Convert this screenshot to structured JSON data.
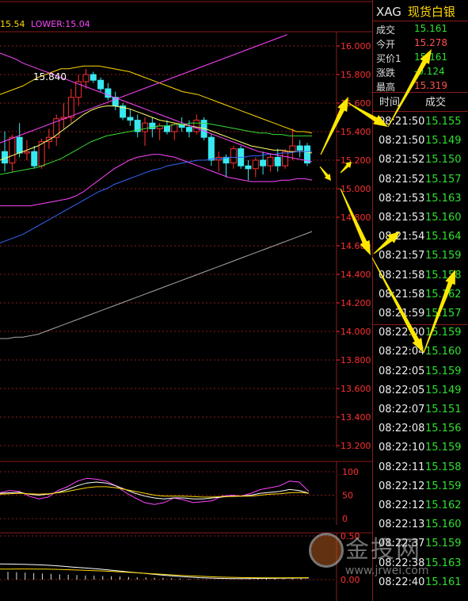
{
  "chart_data": [
    {
      "type": "candlestick",
      "panel": "price",
      "legend": {
        "upper_label": "15.54",
        "lower_label": "LOWER:15.04"
      },
      "annotation": "15.840",
      "ylim": [
        13.2,
        16.1
      ],
      "yticks": [
        "16.000",
        "15.800",
        "15.600",
        "15.400",
        "15.200",
        "15.000",
        "14.800",
        "14.600",
        "14.400",
        "14.200",
        "14.000",
        "13.800",
        "13.600",
        "13.400",
        "13.200"
      ],
      "grid": true,
      "candles": [
        {
          "o": 15.26,
          "h": 15.4,
          "l": 15.12,
          "c": 15.18
        },
        {
          "o": 15.18,
          "h": 15.38,
          "l": 15.12,
          "c": 15.36
        },
        {
          "o": 15.36,
          "h": 15.46,
          "l": 15.22,
          "c": 15.25
        },
        {
          "o": 15.25,
          "h": 15.34,
          "l": 15.2,
          "c": 15.26
        },
        {
          "o": 15.26,
          "h": 15.3,
          "l": 15.14,
          "c": 15.16
        },
        {
          "o": 15.16,
          "h": 15.35,
          "l": 15.14,
          "c": 15.33
        },
        {
          "o": 15.33,
          "h": 15.42,
          "l": 15.28,
          "c": 15.36
        },
        {
          "o": 15.36,
          "h": 15.52,
          "l": 15.3,
          "c": 15.49
        },
        {
          "o": 15.49,
          "h": 15.6,
          "l": 15.42,
          "c": 15.5
        },
        {
          "o": 15.5,
          "h": 15.7,
          "l": 15.46,
          "c": 15.64
        },
        {
          "o": 15.64,
          "h": 15.8,
          "l": 15.58,
          "c": 15.75
        },
        {
          "o": 15.75,
          "h": 15.84,
          "l": 15.7,
          "c": 15.8
        },
        {
          "o": 15.8,
          "h": 15.82,
          "l": 15.74,
          "c": 15.76
        },
        {
          "o": 15.76,
          "h": 15.78,
          "l": 15.68,
          "c": 15.7
        },
        {
          "o": 15.7,
          "h": 15.74,
          "l": 15.62,
          "c": 15.64
        },
        {
          "o": 15.64,
          "h": 15.68,
          "l": 15.55,
          "c": 15.58
        },
        {
          "o": 15.58,
          "h": 15.6,
          "l": 15.48,
          "c": 15.5
        },
        {
          "o": 15.5,
          "h": 15.56,
          "l": 15.44,
          "c": 15.48
        },
        {
          "o": 15.48,
          "h": 15.52,
          "l": 15.36,
          "c": 15.4
        },
        {
          "o": 15.4,
          "h": 15.5,
          "l": 15.3,
          "c": 15.46
        },
        {
          "o": 15.46,
          "h": 15.5,
          "l": 15.36,
          "c": 15.42
        },
        {
          "o": 15.42,
          "h": 15.46,
          "l": 15.34,
          "c": 15.44
        },
        {
          "o": 15.44,
          "h": 15.48,
          "l": 15.38,
          "c": 15.4
        },
        {
          "o": 15.4,
          "h": 15.46,
          "l": 15.34,
          "c": 15.45
        },
        {
          "o": 15.45,
          "h": 15.5,
          "l": 15.4,
          "c": 15.43
        },
        {
          "o": 15.43,
          "h": 15.48,
          "l": 15.36,
          "c": 15.4
        },
        {
          "o": 15.4,
          "h": 15.52,
          "l": 15.38,
          "c": 15.48
        },
        {
          "o": 15.48,
          "h": 15.5,
          "l": 15.34,
          "c": 15.36
        },
        {
          "o": 15.36,
          "h": 15.38,
          "l": 15.16,
          "c": 15.2
        },
        {
          "o": 15.2,
          "h": 15.26,
          "l": 15.12,
          "c": 15.22
        },
        {
          "o": 15.22,
          "h": 15.24,
          "l": 15.08,
          "c": 15.18
        },
        {
          "o": 15.18,
          "h": 15.3,
          "l": 15.14,
          "c": 15.28
        },
        {
          "o": 15.28,
          "h": 15.3,
          "l": 15.14,
          "c": 15.16
        },
        {
          "o": 15.16,
          "h": 15.2,
          "l": 15.06,
          "c": 15.14
        },
        {
          "o": 15.14,
          "h": 15.22,
          "l": 15.08,
          "c": 15.2
        },
        {
          "o": 15.2,
          "h": 15.26,
          "l": 15.1,
          "c": 15.16
        },
        {
          "o": 15.16,
          "h": 15.24,
          "l": 15.12,
          "c": 15.22
        },
        {
          "o": 15.22,
          "h": 15.28,
          "l": 15.12,
          "c": 15.16
        },
        {
          "o": 15.16,
          "h": 15.28,
          "l": 15.14,
          "c": 15.26
        },
        {
          "o": 15.26,
          "h": 15.42,
          "l": 15.2,
          "c": 15.3
        },
        {
          "o": 15.3,
          "h": 15.34,
          "l": 15.22,
          "c": 15.27
        },
        {
          "o": 15.3,
          "h": 15.32,
          "l": 15.16,
          "c": 15.18
        }
      ],
      "lines": [
        {
          "name": "upper",
          "color": "#ffd700",
          "values": [
            15.66,
            15.68,
            15.7,
            15.72,
            15.75,
            15.78,
            15.8,
            15.82,
            15.84,
            15.84,
            15.85,
            15.86,
            15.86,
            15.86,
            15.85,
            15.84,
            15.83,
            15.82,
            15.8,
            15.78,
            15.76,
            15.74,
            15.72,
            15.7,
            15.68,
            15.67,
            15.66,
            15.64,
            15.62,
            15.6,
            15.58,
            15.56,
            15.54,
            15.52,
            15.5,
            15.48,
            15.46,
            15.44,
            15.42,
            15.4,
            15.4,
            15.39
          ]
        },
        {
          "name": "mid",
          "color": "#ffff66",
          "values": [
            15.2,
            15.22,
            15.24,
            15.26,
            15.28,
            15.3,
            15.33,
            15.36,
            15.4,
            15.44,
            15.48,
            15.52,
            15.55,
            15.57,
            15.58,
            15.58,
            15.57,
            15.56,
            15.54,
            15.52,
            15.5,
            15.48,
            15.47,
            15.46,
            15.45,
            15.44,
            15.43,
            15.42,
            15.4,
            15.38,
            15.36,
            15.34,
            15.32,
            15.3,
            15.29,
            15.28,
            15.27,
            15.27,
            15.26,
            15.26,
            15.26,
            15.25
          ]
        },
        {
          "name": "lower",
          "color": "#ff44ff",
          "values": [
            14.88,
            14.88,
            14.88,
            14.88,
            14.88,
            14.89,
            14.9,
            14.91,
            14.92,
            14.93,
            14.95,
            14.98,
            15.02,
            15.06,
            15.1,
            15.14,
            15.17,
            15.2,
            15.22,
            15.23,
            15.24,
            15.24,
            15.23,
            15.22,
            15.2,
            15.18,
            15.16,
            15.14,
            15.12,
            15.1,
            15.08,
            15.07,
            15.06,
            15.05,
            15.05,
            15.05,
            15.05,
            15.06,
            15.06,
            15.07,
            15.07,
            15.06
          ]
        },
        {
          "name": "ma_green",
          "color": "#33dd33",
          "values": [
            15.1,
            15.11,
            15.12,
            15.13,
            15.14,
            15.15,
            15.17,
            15.19,
            15.21,
            15.24,
            15.27,
            15.3,
            15.33,
            15.35,
            15.37,
            15.38,
            15.39,
            15.4,
            15.41,
            15.42,
            15.43,
            15.44,
            15.44,
            15.45,
            15.45,
            15.46,
            15.46,
            15.46,
            15.45,
            15.44,
            15.43,
            15.42,
            15.41,
            15.4,
            15.39,
            15.39,
            15.38,
            15.38,
            15.37,
            15.37,
            15.37,
            15.37
          ]
        },
        {
          "name": "ma_blue",
          "color": "#3366ff",
          "values": [
            14.62,
            14.64,
            14.66,
            14.68,
            14.71,
            14.74,
            14.77,
            14.8,
            14.83,
            14.86,
            14.89,
            14.92,
            14.95,
            14.98,
            15.0,
            15.03,
            15.05,
            15.07,
            15.09,
            15.11,
            15.13,
            15.14,
            15.16,
            15.17,
            15.18,
            15.19,
            15.2,
            15.2,
            15.21,
            15.21,
            15.22,
            15.22,
            15.22,
            15.23,
            15.23,
            15.24,
            15.24,
            15.25,
            15.25,
            15.26,
            15.26,
            15.26
          ]
        },
        {
          "name": "ma_gray",
          "color": "#a8a8a8",
          "values": [
            13.95,
            13.95,
            13.96,
            13.96,
            13.97,
            13.98,
            14.0,
            14.02,
            14.04,
            14.06,
            14.08,
            14.1,
            14.12,
            14.14,
            14.16,
            14.18,
            14.2,
            14.22,
            14.24,
            14.26,
            14.28,
            14.3,
            14.32,
            14.34,
            14.36,
            14.38,
            14.4,
            14.42,
            14.44,
            14.46,
            14.48,
            14.5,
            14.52,
            14.54,
            14.56,
            14.58,
            14.6,
            14.62,
            14.64,
            14.66,
            14.68,
            14.7
          ]
        },
        {
          "name": "trend_down",
          "color": "#ff44ff",
          "values": [
            15.95,
            15.93,
            15.91,
            15.88,
            15.86,
            15.84,
            15.82,
            15.8,
            15.78,
            15.76,
            15.74,
            15.72,
            15.7,
            15.68,
            15.66,
            15.64,
            15.62,
            15.6,
            15.58,
            15.56,
            15.54,
            15.52,
            15.5,
            15.48,
            15.46,
            15.44,
            15.42,
            15.4,
            15.38,
            15.36,
            15.34,
            15.32,
            15.3,
            15.28,
            15.26,
            15.25,
            15.24,
            15.23,
            15.22,
            15.21,
            15.2,
            15.19
          ]
        }
      ],
      "trend_up_line": {
        "color": "#ff44ff",
        "from_index": 10,
        "from_value": 15.5,
        "to_index": 34,
        "to_value": 16.08
      }
    },
    {
      "type": "line",
      "panel": "oscillator",
      "ylim": [
        0,
        100
      ],
      "yticks": [
        "100",
        "50",
        "0"
      ],
      "series": [
        {
          "color": "#ff44ff",
          "values": [
            55,
            60,
            58,
            48,
            42,
            46,
            60,
            68,
            80,
            86,
            84,
            80,
            70,
            56,
            44,
            34,
            30,
            34,
            44,
            40,
            34,
            36,
            38,
            48,
            50,
            48,
            54,
            62,
            66,
            70,
            80,
            78,
            58
          ]
        },
        {
          "color": "#ffffff",
          "values": [
            54,
            55,
            56,
            52,
            50,
            52,
            56,
            62,
            70,
            76,
            78,
            76,
            70,
            62,
            54,
            48,
            44,
            42,
            44,
            44,
            42,
            42,
            44,
            46,
            48,
            48,
            50,
            54,
            56,
            58,
            62,
            60,
            54
          ]
        },
        {
          "color": "#ffd700",
          "values": [
            52,
            53,
            54,
            53,
            52,
            53,
            55,
            58,
            62,
            66,
            68,
            68,
            66,
            62,
            58,
            54,
            50,
            48,
            48,
            48,
            47,
            46,
            46,
            47,
            47,
            48,
            48,
            50,
            52,
            53,
            55,
            56,
            54
          ]
        }
      ]
    },
    {
      "type": "bar",
      "panel": "indicator",
      "ylim": [
        0,
        0.5
      ],
      "yticks": [
        "0.50",
        "0.00"
      ],
      "values": [
        0.09,
        0.085,
        0.08,
        0.075,
        0.07,
        0.065,
        0.06,
        0.056,
        0.052,
        0.048,
        0.045,
        0.042,
        0.038,
        0.034,
        0.03,
        0.027,
        0.024,
        0.021,
        0.018,
        0.015,
        0.012,
        0.009,
        0.006,
        0.003,
        0.002,
        0.001,
        0.002,
        0.004,
        0.006,
        0.008,
        0.01,
        0.011,
        0.012,
        0.013,
        0.014
      ],
      "lines": [
        {
          "color": "#ffffff",
          "values": [
            0.18,
            0.178,
            0.176,
            0.174,
            0.17,
            0.166,
            0.16,
            0.152,
            0.144,
            0.136,
            0.128,
            0.12,
            0.11,
            0.1,
            0.09,
            0.08,
            0.07,
            0.06,
            0.05,
            0.042,
            0.034,
            0.028,
            0.022,
            0.018,
            0.015,
            0.013,
            0.012,
            0.012,
            0.013,
            0.014,
            0.015,
            0.016,
            0.017,
            0.018,
            0.019
          ]
        },
        {
          "color": "#ffd700",
          "values": [
            0.12,
            0.121,
            0.122,
            0.122,
            0.121,
            0.12,
            0.118,
            0.115,
            0.112,
            0.108,
            0.104,
            0.1,
            0.095,
            0.09,
            0.084,
            0.078,
            0.072,
            0.066,
            0.06,
            0.054,
            0.048,
            0.043,
            0.038,
            0.034,
            0.03,
            0.027,
            0.025,
            0.023,
            0.022,
            0.021,
            0.021,
            0.021,
            0.022,
            0.022,
            0.023
          ]
        }
      ]
    }
  ],
  "quote": {
    "symbol": "XAG",
    "name": "现货白银",
    "rows": [
      {
        "label": "成交",
        "value": "15.161",
        "color": "#2fe02f"
      },
      {
        "label": "今开",
        "value": "15.278",
        "color": "#ff5050"
      },
      {
        "label": "买价1",
        "value": "15.161",
        "color": "#2fe02f"
      },
      {
        "label": "涨跌",
        "value": "-0.124",
        "color": "#2fe02f"
      },
      {
        "label": "最高",
        "value": "15.319",
        "color": "#ff5050"
      }
    ]
  },
  "ticks": {
    "headers": {
      "time": "时间",
      "price": "成交"
    },
    "rows": [
      {
        "time": "08:21:50",
        "price": "15.155"
      },
      {
        "time": "08:21:50",
        "price": "15.149"
      },
      {
        "time": "08:21:52",
        "price": "15.150"
      },
      {
        "time": "08:21:52",
        "price": "15.157"
      },
      {
        "time": "08:21:53",
        "price": "15.163"
      },
      {
        "time": "08:21:53",
        "price": "15.160"
      },
      {
        "time": "08:21:54",
        "price": "15.164"
      },
      {
        "time": "08:21:57",
        "price": "15.159"
      },
      {
        "time": "08:21:58",
        "price": "15.158"
      },
      {
        "time": "08:21:58",
        "price": "15.162"
      },
      {
        "time": "08:21:59",
        "price": "15.157"
      },
      {
        "time": "08:22:00",
        "price": "15.159"
      },
      {
        "time": "08:22:04",
        "price": "15.160"
      },
      {
        "time": "08:22:05",
        "price": "15.159"
      },
      {
        "time": "08:22:05",
        "price": "15.149"
      },
      {
        "time": "08:22:07",
        "price": "15.151"
      },
      {
        "time": "08:22:08",
        "price": "15.156"
      },
      {
        "time": "08:22:10",
        "price": "15.159"
      },
      {
        "time": "08:22:11",
        "price": "15.158"
      },
      {
        "time": "08:22:12",
        "price": "15.159"
      },
      {
        "time": "08:22:12",
        "price": "15.162"
      },
      {
        "time": "08:22:13",
        "price": "15.160"
      },
      {
        "time": "08:22:37",
        "price": "15.159"
      },
      {
        "time": "08:22:38",
        "price": "15.163"
      },
      {
        "time": "08:22:40",
        "price": "15.161"
      }
    ]
  },
  "watermark": {
    "text": "金投网",
    "url": "www.jrwei.com"
  },
  "colors": {
    "grid": "#8a1b1b",
    "axis_text": "#ff3030",
    "candle_up": "#ff3030",
    "candle_down": "#38e8f0",
    "arrow": "#ffe800"
  }
}
